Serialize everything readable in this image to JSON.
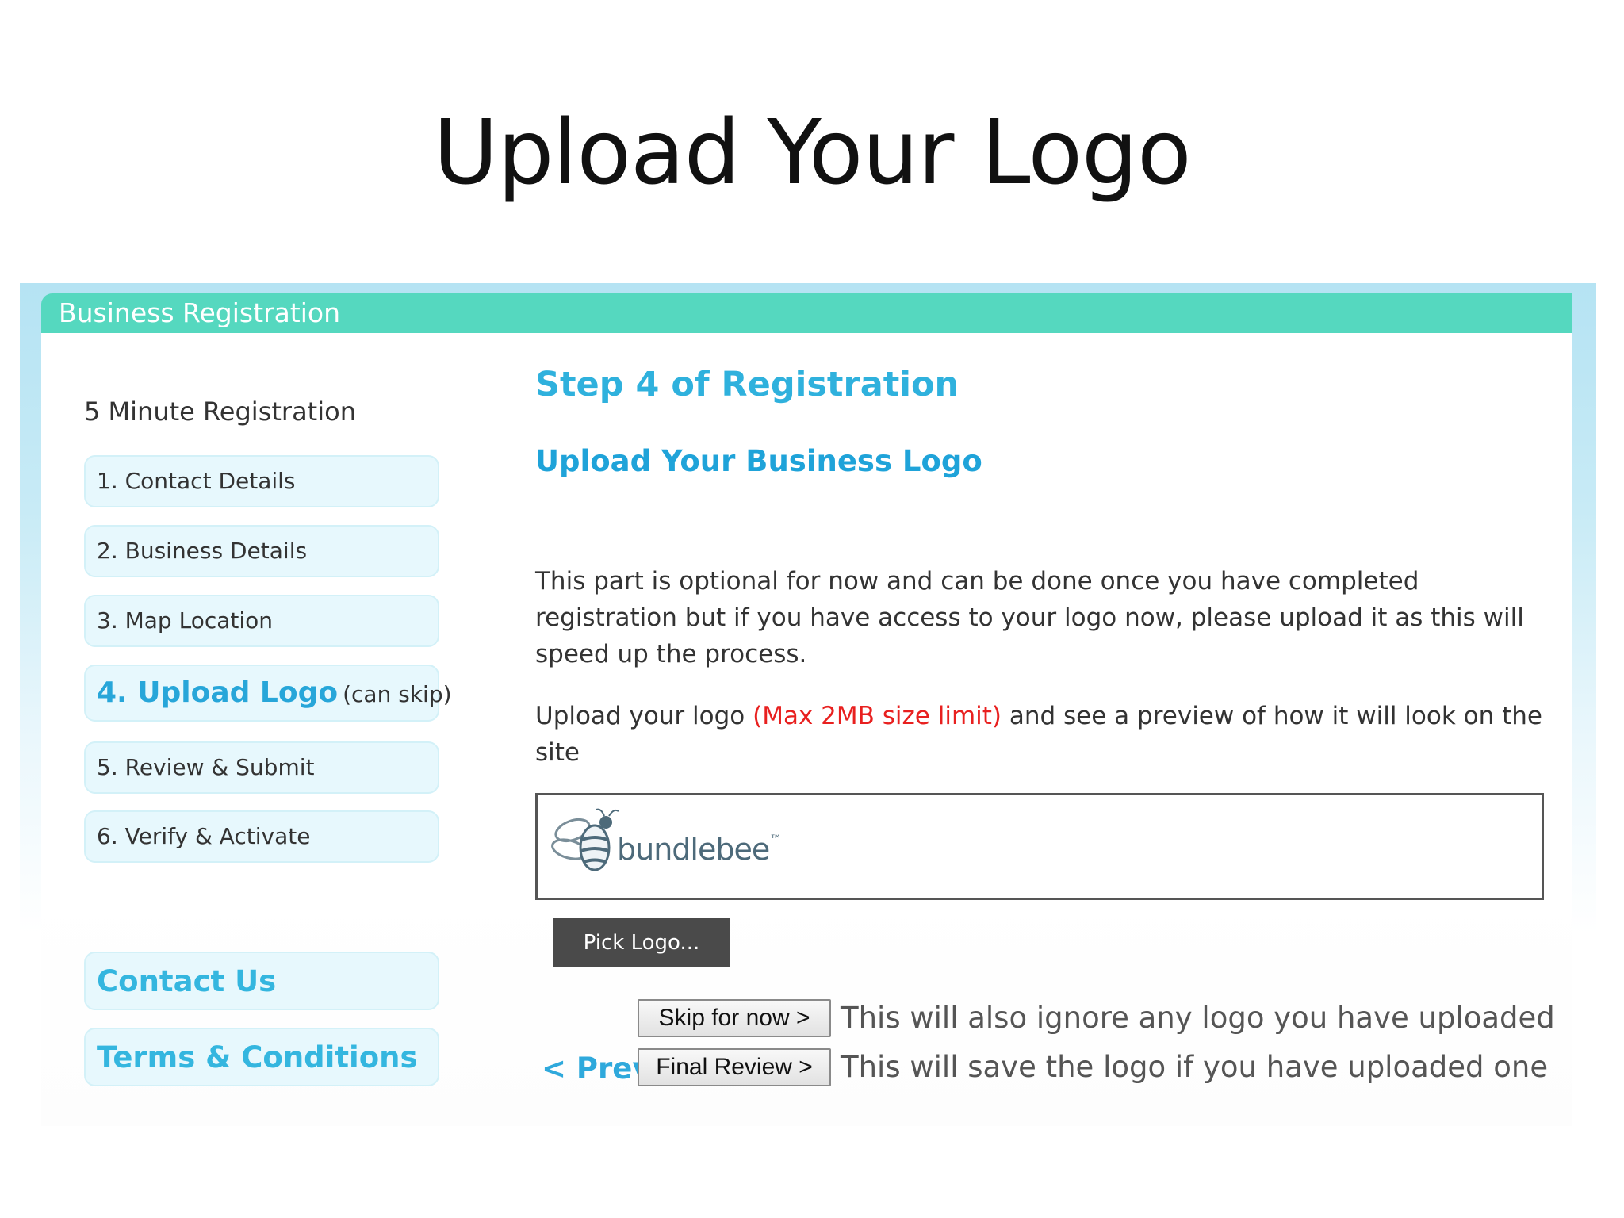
{
  "slide": {
    "title": "Upload Your Logo"
  },
  "app": {
    "header_title": "Business Registration"
  },
  "sidebar": {
    "heading": "5 Minute Registration",
    "steps": [
      {
        "label": "1. Contact Details"
      },
      {
        "label": "2. Business Details"
      },
      {
        "label": "3. Map Location"
      },
      {
        "label": "4. Upload Logo",
        "note": "(can skip)"
      },
      {
        "label": "5. Review & Submit"
      },
      {
        "label": "6. Verify & Activate"
      }
    ],
    "links": [
      {
        "label": "Contact Us"
      },
      {
        "label": "Terms & Conditions"
      }
    ]
  },
  "main": {
    "step_title": "Step 4 of Registration",
    "subtitle": "Upload Your Business Logo",
    "intro": "This part is optional for now and can be done once you have completed registration but if you have access to your logo now, please upload it as this will speed up the process.",
    "upload_prefix": "Upload your logo ",
    "upload_limit": "(Max 2MB size limit)",
    "upload_suffix": " and see a preview of how it will look on the site",
    "logo_preview_text": "bundlebee",
    "logo_tm": "™",
    "pick_button": "Pick Logo...",
    "skip_button": "Skip for now >",
    "skip_note": "This will also ignore any logo you have uploaded",
    "final_button": "Final Review >",
    "final_note": "This will save the logo if you have uploaded one",
    "prev_link": "< Prev"
  },
  "colors": {
    "header_bar": "#55d8bf",
    "accent_blue": "#2fb1dd",
    "limit_red": "#e8201f",
    "sidebar_item_bg": "#e7f8fd"
  }
}
